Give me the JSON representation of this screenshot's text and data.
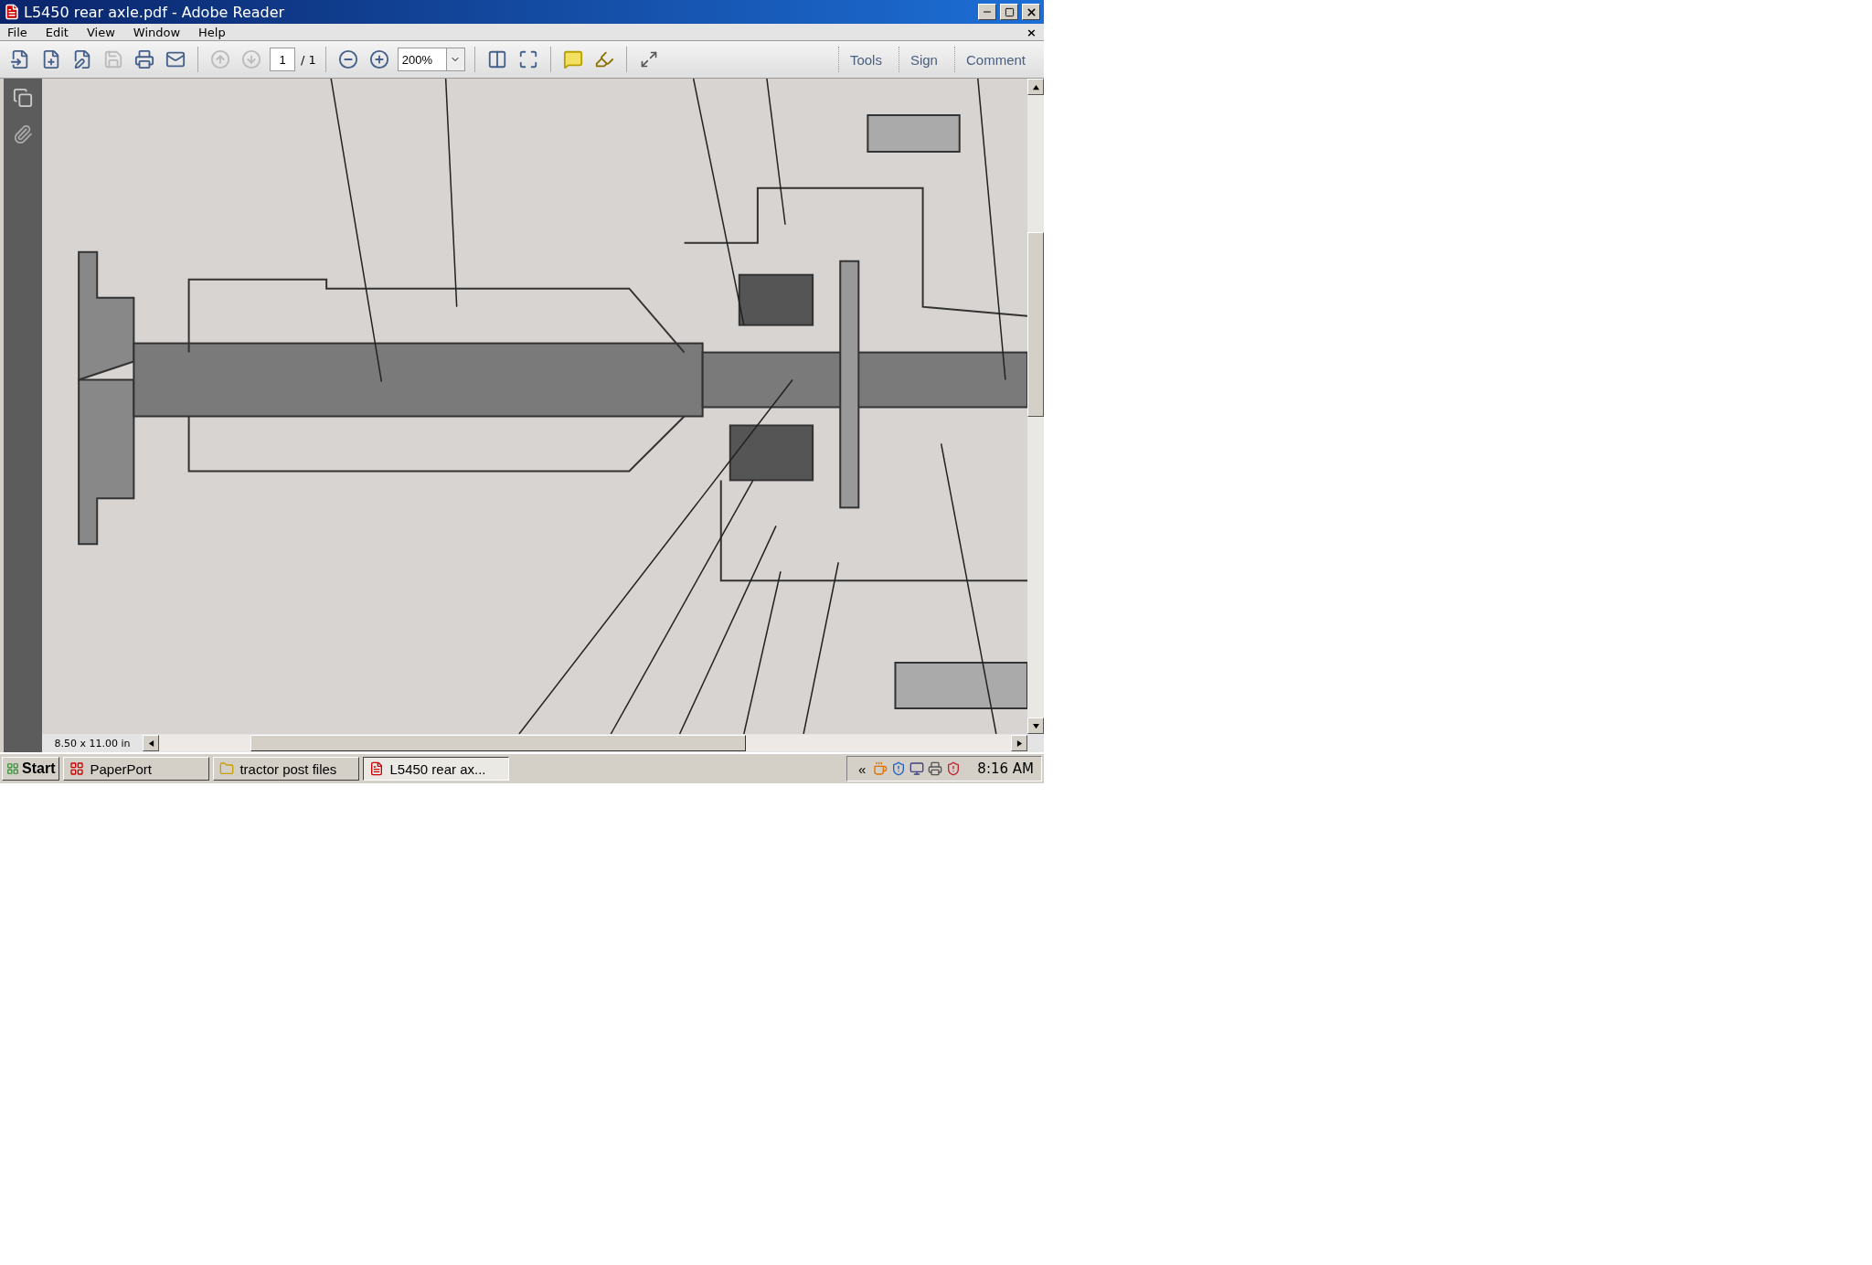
{
  "window": {
    "title": "L5450 rear axle.pdf - Adobe Reader"
  },
  "menu": {
    "items": [
      "File",
      "Edit",
      "View",
      "Window",
      "Help"
    ],
    "close_glyph": "×"
  },
  "toolbar": {
    "buttons": [
      {
        "kind": "create",
        "disabled": false
      },
      {
        "kind": "convert",
        "disabled": false
      },
      {
        "kind": "edit",
        "disabled": false
      },
      {
        "kind": "save",
        "disabled": true
      },
      {
        "kind": "print",
        "disabled": false
      },
      {
        "kind": "mail",
        "disabled": false
      }
    ],
    "nav_buttons": [
      {
        "kind": "up",
        "disabled": true
      },
      {
        "kind": "down",
        "disabled": true
      }
    ],
    "page_number": "1",
    "page_total": "/ 1",
    "zoom": "200%",
    "panes": [
      {
        "label": "Tools"
      },
      {
        "label": "Sign"
      },
      {
        "label": "Comment"
      }
    ]
  },
  "status": {
    "page_size": "8.50 x 11.00 in"
  },
  "taskbar": {
    "start": "Start",
    "tasks": [
      {
        "label": "PaperPort",
        "kind": "app",
        "selected": false
      },
      {
        "label": "tractor post files",
        "kind": "folder",
        "selected": false
      },
      {
        "label": "L5450 rear ax...",
        "kind": "pdf",
        "selected": true
      }
    ],
    "tray_toggle": "«",
    "clock": "8:16 AM"
  }
}
